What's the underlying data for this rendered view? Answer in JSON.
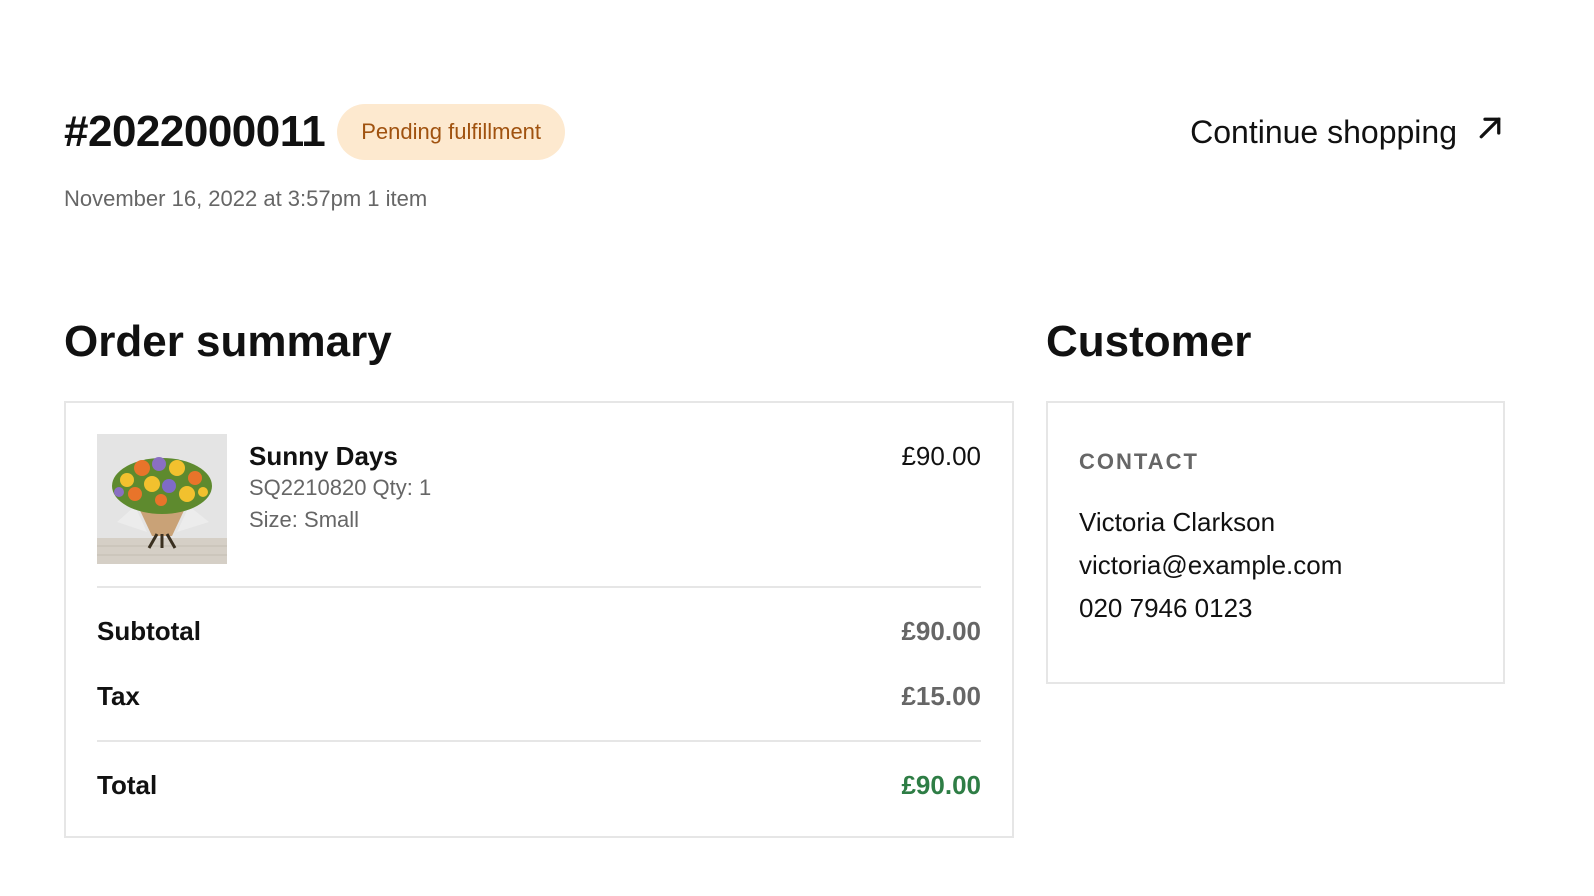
{
  "order": {
    "number": "#2022000011",
    "status": "Pending fulfillment",
    "meta": "November 16, 2022 at 3:57pm 1 item",
    "continue_label": "Continue shopping"
  },
  "colors": {
    "badge_bg": "#fde9cf",
    "badge_text": "#a0520f",
    "total_green": "#2e7d45"
  },
  "summary": {
    "heading": "Order summary",
    "item": {
      "name": "Sunny Days",
      "sku_qty": "SQ2210820 Qty: 1",
      "size": "Size: Small",
      "price": "£90.00"
    },
    "subtotal_label": "Subtotal",
    "subtotal_value": "£90.00",
    "tax_label": "Tax",
    "tax_value": "£15.00",
    "total_label": "Total",
    "total_value": "£90.00"
  },
  "customer": {
    "heading": "Customer",
    "contact_label": "CONTACT",
    "name": "Victoria Clarkson",
    "email": "victoria@example.com",
    "phone": "020 7946 0123"
  },
  "icons": {
    "continue": "arrow-up-right-icon"
  }
}
